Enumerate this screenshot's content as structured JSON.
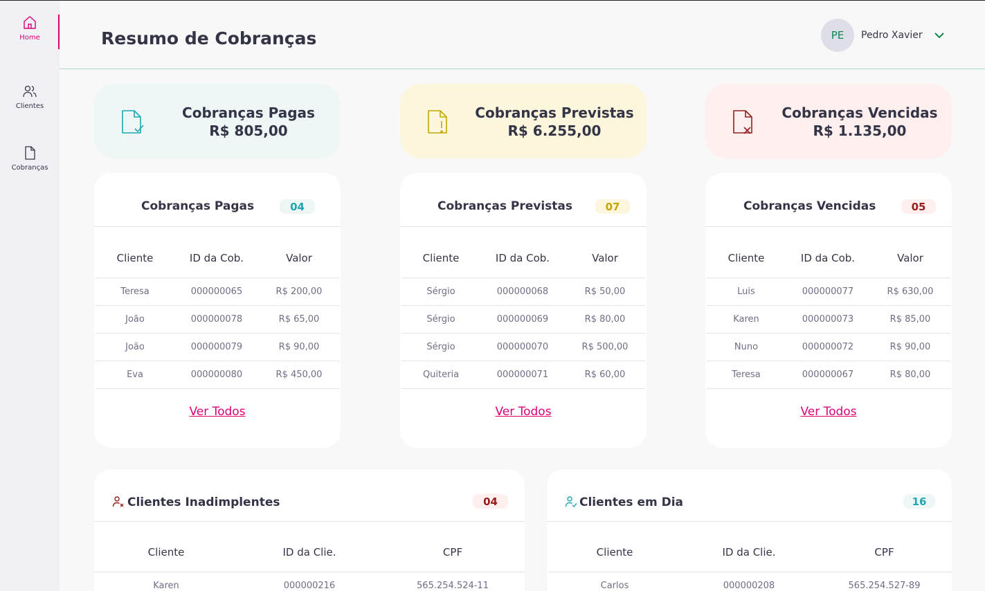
{
  "sidebar": {
    "items": [
      {
        "label": "Home",
        "icon": "home-icon",
        "active": true
      },
      {
        "label": "Clientes",
        "icon": "users-icon"
      },
      {
        "label": "Cobranças",
        "icon": "document-icon"
      }
    ]
  },
  "header": {
    "title": "Resumo de Cobranças",
    "user": {
      "initials": "PE",
      "name": "Pedro Xavier"
    }
  },
  "summary": {
    "paid": {
      "title": "Cobranças Pagas",
      "value": "R$ 805,00"
    },
    "expected": {
      "title": "Cobranças Previstas",
      "value": "R$ 6.255,00"
    },
    "overdue": {
      "title": "Cobranças Vencidas",
      "value": "R$ 1.135,00"
    }
  },
  "charges_columns": [
    "Cliente",
    "ID da Cob.",
    "Valor"
  ],
  "view_all": "Ver Todos",
  "paid_table": {
    "title": "Cobranças Pagas",
    "count": "04",
    "rows": [
      [
        "Teresa",
        "000000065",
        "R$ 200,00"
      ],
      [
        "João",
        "000000078",
        "R$ 65,00"
      ],
      [
        "João",
        "000000079",
        "R$ 90,00"
      ],
      [
        "Eva",
        "000000080",
        "R$ 450,00"
      ]
    ]
  },
  "expected_table": {
    "title": "Cobranças Previstas",
    "count": "07",
    "rows": [
      [
        "Sérgio",
        "000000068",
        "R$ 50,00"
      ],
      [
        "Sérgio",
        "000000069",
        "R$ 80,00"
      ],
      [
        "Sérgio",
        "000000070",
        "R$ 500,00"
      ],
      [
        "Quiteria",
        "000000071",
        "R$ 60,00"
      ]
    ]
  },
  "overdue_table": {
    "title": "Cobranças Vencidas",
    "count": "05",
    "rows": [
      [
        "Luis",
        "000000077",
        "R$ 630,00"
      ],
      [
        "Karen",
        "000000073",
        "R$ 85,00"
      ],
      [
        "Nuno",
        "000000072",
        "R$ 90,00"
      ],
      [
        "Teresa",
        "000000067",
        "R$ 80,00"
      ]
    ]
  },
  "clients_columns": [
    "Cliente",
    "ID da Clie.",
    "CPF"
  ],
  "defaulters": {
    "title": "Clientes Inadimplentes",
    "count": "04",
    "rows": [
      [
        "Karen",
        "000000216",
        "565.254.524-11"
      ]
    ]
  },
  "up_to_date": {
    "title": "Clientes em Dia",
    "count": "16",
    "rows": [
      [
        "Carlos",
        "000000208",
        "565.254.527-89"
      ]
    ]
  },
  "colors": {
    "accent": "#da0175",
    "paid_bg": "#eef6f6",
    "expected_bg": "#fcf6dc",
    "overdue_bg": "#ffefef"
  }
}
